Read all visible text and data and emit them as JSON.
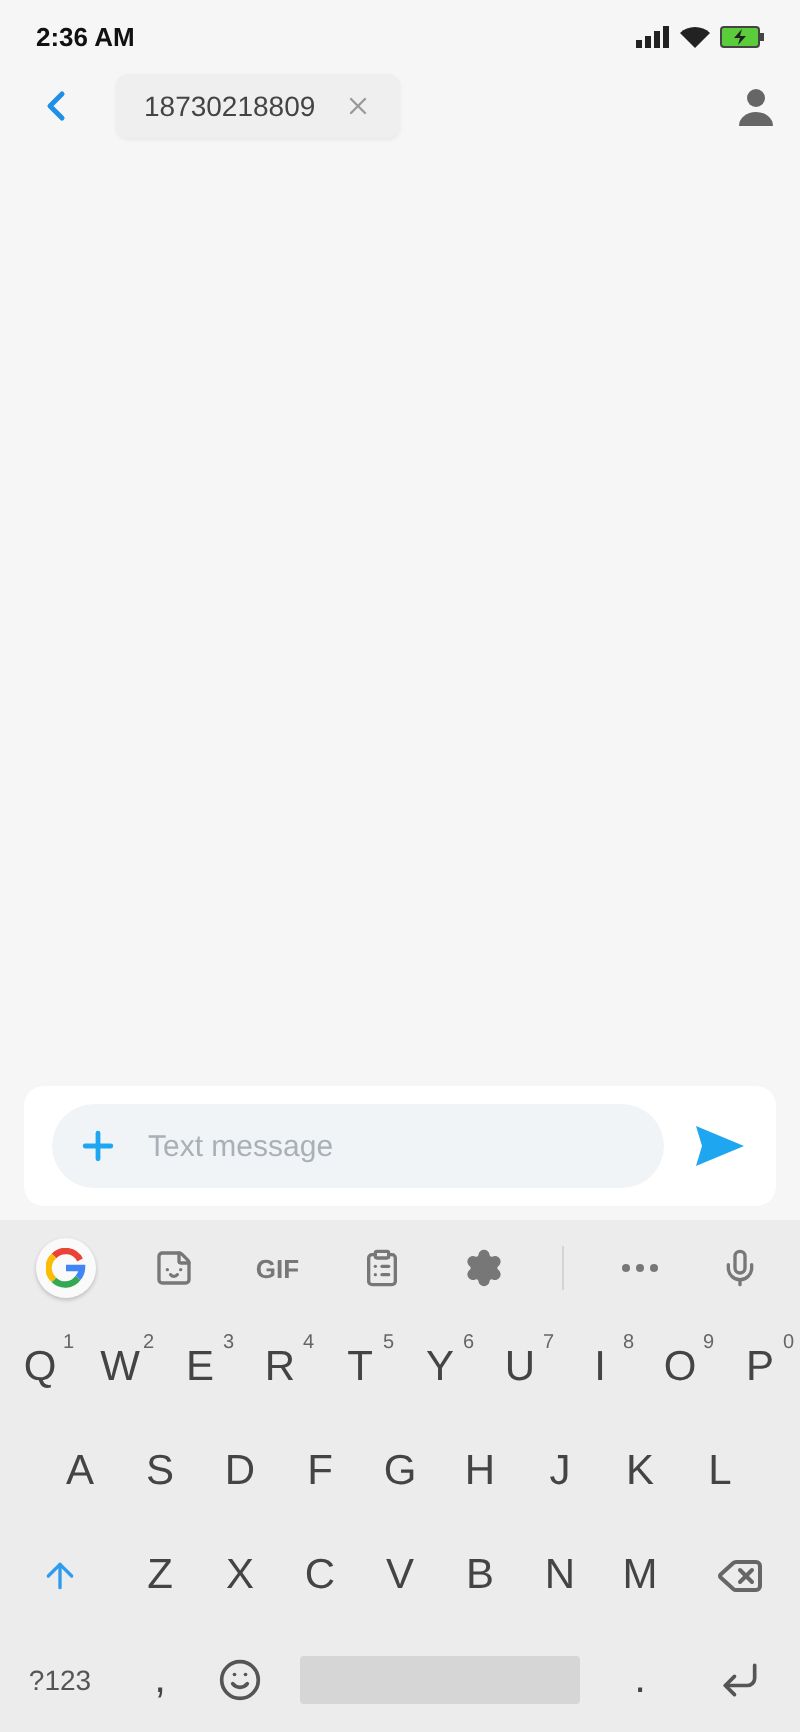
{
  "status_bar": {
    "time": "2:36 AM"
  },
  "header": {
    "recipient": "18730218809"
  },
  "compose": {
    "placeholder": "Text message"
  },
  "keyboard_toolbar": {
    "gif": "GIF"
  },
  "keyboard": {
    "rows": [
      {
        "keys": [
          {
            "kind": "letter",
            "label": "Q",
            "hint": "1"
          },
          {
            "kind": "letter",
            "label": "W",
            "hint": "2"
          },
          {
            "kind": "letter",
            "label": "E",
            "hint": "3"
          },
          {
            "kind": "letter",
            "label": "R",
            "hint": "4"
          },
          {
            "kind": "letter",
            "label": "T",
            "hint": "5"
          },
          {
            "kind": "letter",
            "label": "Y",
            "hint": "6"
          },
          {
            "kind": "letter",
            "label": "U",
            "hint": "7"
          },
          {
            "kind": "letter",
            "label": "I",
            "hint": "8"
          },
          {
            "kind": "letter",
            "label": "O",
            "hint": "9"
          },
          {
            "kind": "letter",
            "label": "P",
            "hint": "0"
          }
        ]
      },
      {
        "keys": [
          {
            "kind": "letter",
            "label": "A"
          },
          {
            "kind": "letter",
            "label": "S"
          },
          {
            "kind": "letter",
            "label": "D"
          },
          {
            "kind": "letter",
            "label": "F"
          },
          {
            "kind": "letter",
            "label": "G"
          },
          {
            "kind": "letter",
            "label": "H"
          },
          {
            "kind": "letter",
            "label": "J"
          },
          {
            "kind": "letter",
            "label": "K"
          },
          {
            "kind": "letter",
            "label": "L"
          }
        ]
      },
      {
        "keys": [
          {
            "kind": "shift"
          },
          {
            "kind": "letter",
            "label": "Z"
          },
          {
            "kind": "letter",
            "label": "X"
          },
          {
            "kind": "letter",
            "label": "C"
          },
          {
            "kind": "letter",
            "label": "V"
          },
          {
            "kind": "letter",
            "label": "B"
          },
          {
            "kind": "letter",
            "label": "N"
          },
          {
            "kind": "letter",
            "label": "M"
          },
          {
            "kind": "backspace"
          }
        ]
      },
      {
        "keys": [
          {
            "kind": "symbols",
            "label": "?123"
          },
          {
            "kind": "letter",
            "label": ","
          },
          {
            "kind": "emoji"
          },
          {
            "kind": "space"
          },
          {
            "kind": "letter",
            "label": "."
          },
          {
            "kind": "enter"
          }
        ]
      }
    ]
  }
}
